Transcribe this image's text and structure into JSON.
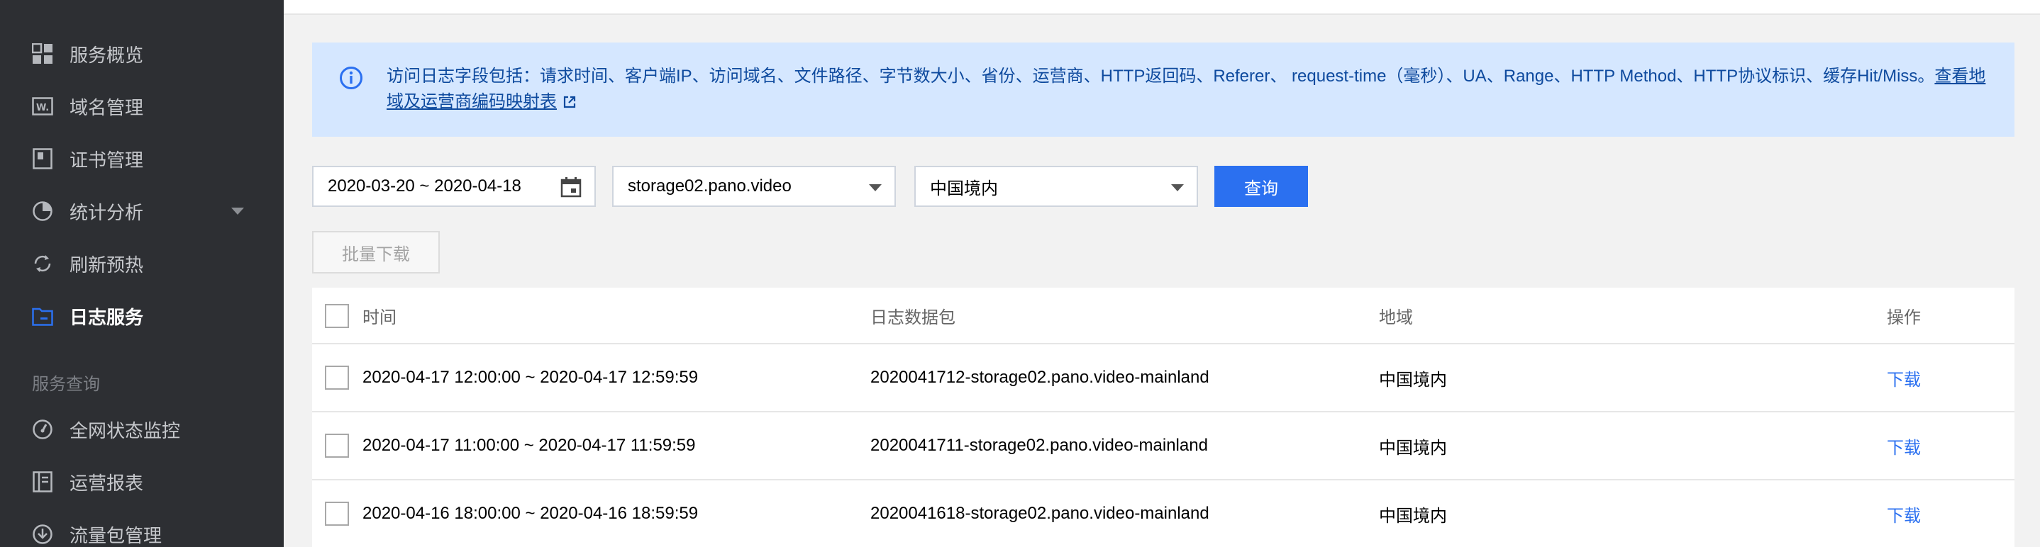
{
  "sidebar": {
    "items": [
      {
        "label": "服务概览",
        "icon": "grid-icon"
      },
      {
        "label": "域名管理",
        "icon": "domain-icon"
      },
      {
        "label": "证书管理",
        "icon": "certificate-icon"
      },
      {
        "label": "统计分析",
        "icon": "pie-chart-icon"
      },
      {
        "label": "刷新预热",
        "icon": "refresh-icon"
      },
      {
        "label": "日志服务",
        "icon": "folder-icon"
      },
      {
        "label": "全网状态监控",
        "icon": "gauge-icon"
      },
      {
        "label": "运营报表",
        "icon": "report-icon"
      },
      {
        "label": "流量包管理",
        "icon": "package-icon"
      }
    ],
    "section_label": "服务查询",
    "active_color": "#2b70f0"
  },
  "notice": {
    "text": "访问日志字段包括：请求时间、客户端IP、访问域名、文件路径、字节数大小、省份、运营商、HTTP返回码、Referer、 request-time（毫秒）、UA、Range、HTTP Method、HTTP协议标识、缓存Hit/Miss。",
    "link_text": "查看地域及运营商编码映射表"
  },
  "filters": {
    "date_range": "2020-03-20 ~ 2020-04-18",
    "domain": "storage02.pano.video",
    "region": "中国境内",
    "query_label": "查询",
    "batch_download_label": "批量下载"
  },
  "table": {
    "headers": {
      "time": "时间",
      "package": "日志数据包",
      "region": "地域",
      "action": "操作"
    },
    "rows": [
      {
        "time": "2020-04-17 12:00:00 ~ 2020-04-17 12:59:59",
        "package": "2020041712-storage02.pano.video-mainland",
        "region": "中国境内",
        "action": "下载"
      },
      {
        "time": "2020-04-17 11:00:00 ~ 2020-04-17 11:59:59",
        "package": "2020041711-storage02.pano.video-mainland",
        "region": "中国境内",
        "action": "下载"
      },
      {
        "time": "2020-04-16 18:00:00 ~ 2020-04-16 18:59:59",
        "package": "2020041618-storage02.pano.video-mainland",
        "region": "中国境内",
        "action": "下载"
      }
    ]
  },
  "colors": {
    "sidebar_bg": "#2d2f33",
    "primary": "#2b70f0",
    "notice_bg": "#d5e7ff",
    "notice_text": "#0e4a9e"
  }
}
